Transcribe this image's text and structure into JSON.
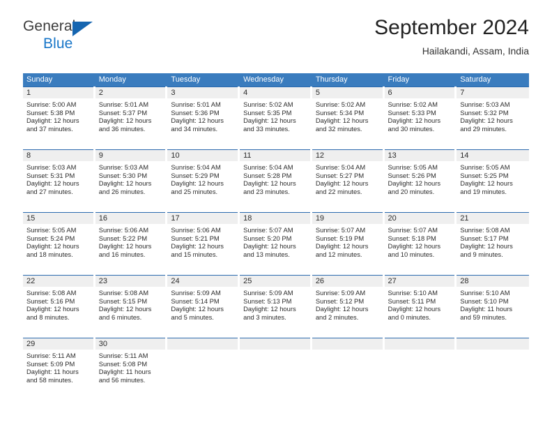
{
  "brand": {
    "name_top": "General",
    "name_bottom": "Blue",
    "triangle_icon": "blue-triangle-icon",
    "accent_color": "#1876c8"
  },
  "header": {
    "title": "September 2024",
    "subtitle": "Hailakandi, Assam, India"
  },
  "calendar": {
    "header_color": "#3a7cbe",
    "cell_border_color": "#2a69ae",
    "day_number_bg": "#efefef",
    "weekdays": [
      "Sunday",
      "Monday",
      "Tuesday",
      "Wednesday",
      "Thursday",
      "Friday",
      "Saturday"
    ],
    "weeks": [
      [
        {
          "day": "1",
          "sunrise": "Sunrise: 5:00 AM",
          "sunset": "Sunset: 5:38 PM",
          "daylight_line1": "Daylight: 12 hours",
          "daylight_line2": "and 37 minutes."
        },
        {
          "day": "2",
          "sunrise": "Sunrise: 5:01 AM",
          "sunset": "Sunset: 5:37 PM",
          "daylight_line1": "Daylight: 12 hours",
          "daylight_line2": "and 36 minutes."
        },
        {
          "day": "3",
          "sunrise": "Sunrise: 5:01 AM",
          "sunset": "Sunset: 5:36 PM",
          "daylight_line1": "Daylight: 12 hours",
          "daylight_line2": "and 34 minutes."
        },
        {
          "day": "4",
          "sunrise": "Sunrise: 5:02 AM",
          "sunset": "Sunset: 5:35 PM",
          "daylight_line1": "Daylight: 12 hours",
          "daylight_line2": "and 33 minutes."
        },
        {
          "day": "5",
          "sunrise": "Sunrise: 5:02 AM",
          "sunset": "Sunset: 5:34 PM",
          "daylight_line1": "Daylight: 12 hours",
          "daylight_line2": "and 32 minutes."
        },
        {
          "day": "6",
          "sunrise": "Sunrise: 5:02 AM",
          "sunset": "Sunset: 5:33 PM",
          "daylight_line1": "Daylight: 12 hours",
          "daylight_line2": "and 30 minutes."
        },
        {
          "day": "7",
          "sunrise": "Sunrise: 5:03 AM",
          "sunset": "Sunset: 5:32 PM",
          "daylight_line1": "Daylight: 12 hours",
          "daylight_line2": "and 29 minutes."
        }
      ],
      [
        {
          "day": "8",
          "sunrise": "Sunrise: 5:03 AM",
          "sunset": "Sunset: 5:31 PM",
          "daylight_line1": "Daylight: 12 hours",
          "daylight_line2": "and 27 minutes."
        },
        {
          "day": "9",
          "sunrise": "Sunrise: 5:03 AM",
          "sunset": "Sunset: 5:30 PM",
          "daylight_line1": "Daylight: 12 hours",
          "daylight_line2": "and 26 minutes."
        },
        {
          "day": "10",
          "sunrise": "Sunrise: 5:04 AM",
          "sunset": "Sunset: 5:29 PM",
          "daylight_line1": "Daylight: 12 hours",
          "daylight_line2": "and 25 minutes."
        },
        {
          "day": "11",
          "sunrise": "Sunrise: 5:04 AM",
          "sunset": "Sunset: 5:28 PM",
          "daylight_line1": "Daylight: 12 hours",
          "daylight_line2": "and 23 minutes."
        },
        {
          "day": "12",
          "sunrise": "Sunrise: 5:04 AM",
          "sunset": "Sunset: 5:27 PM",
          "daylight_line1": "Daylight: 12 hours",
          "daylight_line2": "and 22 minutes."
        },
        {
          "day": "13",
          "sunrise": "Sunrise: 5:05 AM",
          "sunset": "Sunset: 5:26 PM",
          "daylight_line1": "Daylight: 12 hours",
          "daylight_line2": "and 20 minutes."
        },
        {
          "day": "14",
          "sunrise": "Sunrise: 5:05 AM",
          "sunset": "Sunset: 5:25 PM",
          "daylight_line1": "Daylight: 12 hours",
          "daylight_line2": "and 19 minutes."
        }
      ],
      [
        {
          "day": "15",
          "sunrise": "Sunrise: 5:05 AM",
          "sunset": "Sunset: 5:24 PM",
          "daylight_line1": "Daylight: 12 hours",
          "daylight_line2": "and 18 minutes."
        },
        {
          "day": "16",
          "sunrise": "Sunrise: 5:06 AM",
          "sunset": "Sunset: 5:22 PM",
          "daylight_line1": "Daylight: 12 hours",
          "daylight_line2": "and 16 minutes."
        },
        {
          "day": "17",
          "sunrise": "Sunrise: 5:06 AM",
          "sunset": "Sunset: 5:21 PM",
          "daylight_line1": "Daylight: 12 hours",
          "daylight_line2": "and 15 minutes."
        },
        {
          "day": "18",
          "sunrise": "Sunrise: 5:07 AM",
          "sunset": "Sunset: 5:20 PM",
          "daylight_line1": "Daylight: 12 hours",
          "daylight_line2": "and 13 minutes."
        },
        {
          "day": "19",
          "sunrise": "Sunrise: 5:07 AM",
          "sunset": "Sunset: 5:19 PM",
          "daylight_line1": "Daylight: 12 hours",
          "daylight_line2": "and 12 minutes."
        },
        {
          "day": "20",
          "sunrise": "Sunrise: 5:07 AM",
          "sunset": "Sunset: 5:18 PM",
          "daylight_line1": "Daylight: 12 hours",
          "daylight_line2": "and 10 minutes."
        },
        {
          "day": "21",
          "sunrise": "Sunrise: 5:08 AM",
          "sunset": "Sunset: 5:17 PM",
          "daylight_line1": "Daylight: 12 hours",
          "daylight_line2": "and 9 minutes."
        }
      ],
      [
        {
          "day": "22",
          "sunrise": "Sunrise: 5:08 AM",
          "sunset": "Sunset: 5:16 PM",
          "daylight_line1": "Daylight: 12 hours",
          "daylight_line2": "and 8 minutes."
        },
        {
          "day": "23",
          "sunrise": "Sunrise: 5:08 AM",
          "sunset": "Sunset: 5:15 PM",
          "daylight_line1": "Daylight: 12 hours",
          "daylight_line2": "and 6 minutes."
        },
        {
          "day": "24",
          "sunrise": "Sunrise: 5:09 AM",
          "sunset": "Sunset: 5:14 PM",
          "daylight_line1": "Daylight: 12 hours",
          "daylight_line2": "and 5 minutes."
        },
        {
          "day": "25",
          "sunrise": "Sunrise: 5:09 AM",
          "sunset": "Sunset: 5:13 PM",
          "daylight_line1": "Daylight: 12 hours",
          "daylight_line2": "and 3 minutes."
        },
        {
          "day": "26",
          "sunrise": "Sunrise: 5:09 AM",
          "sunset": "Sunset: 5:12 PM",
          "daylight_line1": "Daylight: 12 hours",
          "daylight_line2": "and 2 minutes."
        },
        {
          "day": "27",
          "sunrise": "Sunrise: 5:10 AM",
          "sunset": "Sunset: 5:11 PM",
          "daylight_line1": "Daylight: 12 hours",
          "daylight_line2": "and 0 minutes."
        },
        {
          "day": "28",
          "sunrise": "Sunrise: 5:10 AM",
          "sunset": "Sunset: 5:10 PM",
          "daylight_line1": "Daylight: 11 hours",
          "daylight_line2": "and 59 minutes."
        }
      ],
      [
        {
          "day": "29",
          "sunrise": "Sunrise: 5:11 AM",
          "sunset": "Sunset: 5:09 PM",
          "daylight_line1": "Daylight: 11 hours",
          "daylight_line2": "and 58 minutes."
        },
        {
          "day": "30",
          "sunrise": "Sunrise: 5:11 AM",
          "sunset": "Sunset: 5:08 PM",
          "daylight_line1": "Daylight: 11 hours",
          "daylight_line2": "and 56 minutes."
        },
        {
          "day": "",
          "sunrise": "",
          "sunset": "",
          "daylight_line1": "",
          "daylight_line2": ""
        },
        {
          "day": "",
          "sunrise": "",
          "sunset": "",
          "daylight_line1": "",
          "daylight_line2": ""
        },
        {
          "day": "",
          "sunrise": "",
          "sunset": "",
          "daylight_line1": "",
          "daylight_line2": ""
        },
        {
          "day": "",
          "sunrise": "",
          "sunset": "",
          "daylight_line1": "",
          "daylight_line2": ""
        },
        {
          "day": "",
          "sunrise": "",
          "sunset": "",
          "daylight_line1": "",
          "daylight_line2": ""
        }
      ]
    ]
  }
}
